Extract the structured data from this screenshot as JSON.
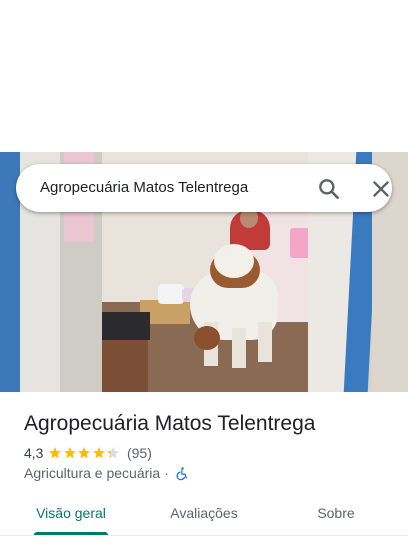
{
  "search": {
    "query": "Agropecuária Matos Telentrega"
  },
  "place": {
    "name": "Agropecuária Matos Telentrega",
    "rating": "4,3",
    "rating_stars": 4.3,
    "review_count": "(95)",
    "category": "Agricultura e pecuária",
    "separator": "·",
    "accessibility_icon": "wheelchair-icon"
  },
  "tabs": [
    {
      "label": "Visão geral",
      "active": true
    },
    {
      "label": "Avaliações",
      "active": false
    },
    {
      "label": "Sobre",
      "active": false
    }
  ],
  "colors": {
    "accent": "#00796b",
    "star": "#fbbc04",
    "accessibility": "#1a73e8"
  }
}
